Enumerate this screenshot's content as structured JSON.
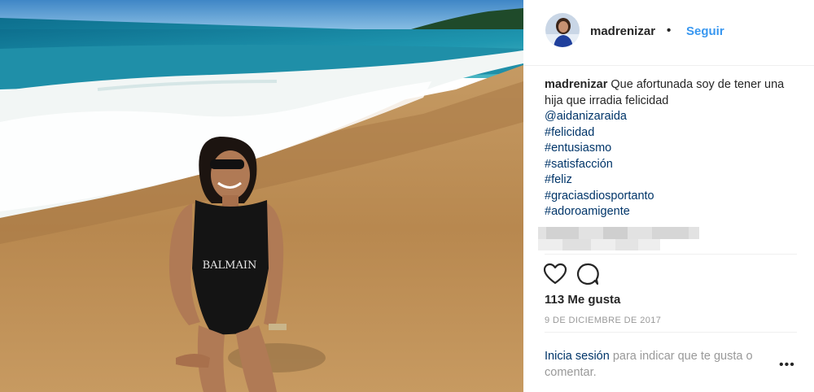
{
  "post": {
    "username": "madrenizar",
    "separator": "•",
    "follow_label": "Seguir",
    "caption": {
      "username": "madrenizar",
      "text": "Que afortunada soy de tener una hija que irradia felicidad",
      "mention": "@aidanizaraida",
      "hashtags": [
        "#felicidad",
        "#entusiasmo",
        "#satisfacción",
        "#feliz",
        "#graciasdiosportanto",
        "#adoroamigente"
      ]
    },
    "likes": "113 Me gusta",
    "date": "9 DE DICIEMBRE DE 2017",
    "login_link": "Inicia sesión",
    "login_text": " para indicar que te gusta o comentar.",
    "more_label": "•••",
    "photo_text": "BALMAIN",
    "icons": {
      "like": "heart-icon",
      "comment": "comment-icon",
      "more": "more-options-icon"
    },
    "colors": {
      "follow": "#3897f0",
      "link": "#003569",
      "muted": "#999999"
    }
  }
}
